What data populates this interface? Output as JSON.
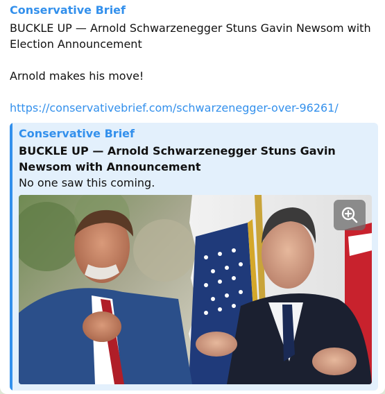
{
  "message": {
    "sender": "Conservative Brief",
    "headline": "BUCKLE UP — Arnold Schwarzenegger Stuns Gavin Newsom with Election Announcement",
    "tagline": "Arnold makes his move!",
    "link": "https://conservativebrief.com/schwarzenegger-over-96261/"
  },
  "preview": {
    "site_name": "Conservative Brief",
    "title": "BUCKLE UP — Arnold Schwarzenegger Stuns Gavin Newsom with Announcement",
    "description": "No one saw this coming.",
    "image_icon": "zoom-in-icon"
  },
  "colors": {
    "accent": "#3390ec",
    "preview_bg": "#e3f0fc"
  }
}
